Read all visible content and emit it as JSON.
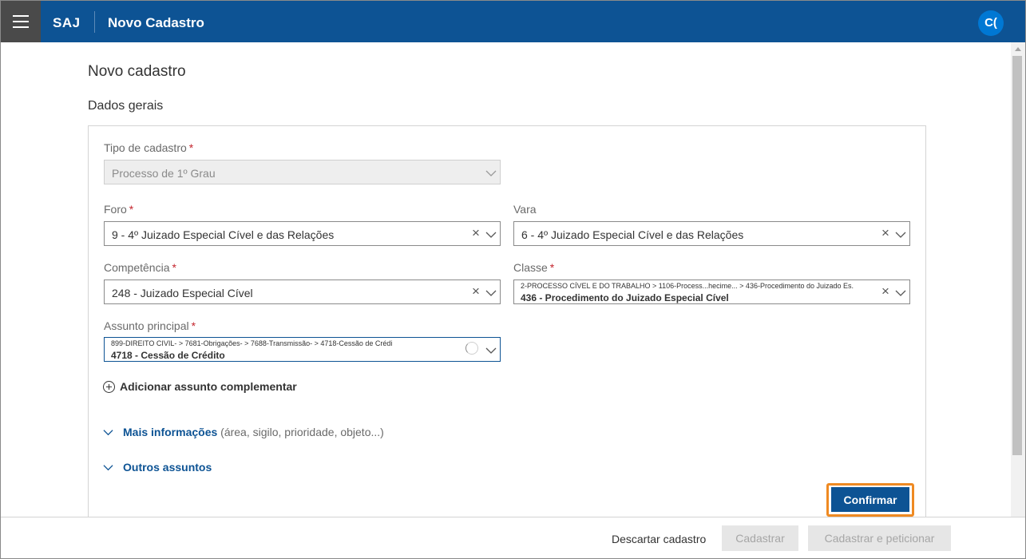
{
  "header": {
    "brand": "SAJ",
    "title": "Novo Cadastro",
    "avatar_initials": "C("
  },
  "page": {
    "title": "Novo cadastro",
    "section": "Dados gerais"
  },
  "form": {
    "tipo_cadastro": {
      "label": "Tipo de cadastro",
      "required_mark": "*",
      "value": "Processo de 1º Grau"
    },
    "foro": {
      "label": "Foro",
      "required_mark": "*",
      "value": "9 - 4º Juizado Especial Cível e das Relações"
    },
    "vara": {
      "label": "Vara",
      "value": "6 - 4º Juizado Especial Cível e das Relações"
    },
    "competencia": {
      "label": "Competência",
      "required_mark": "*",
      "value": "248 - Juizado Especial Cível"
    },
    "classe": {
      "label": "Classe",
      "required_mark": "*",
      "path": "2-PROCESSO CÍVEL E DO TRABALHO > 1106-Process...hecime... > 436-Procedimento do Juizado Es.",
      "value": "436 - Procedimento do Juizado Especial Cível"
    },
    "assunto_principal": {
      "label": "Assunto principal",
      "required_mark": "*",
      "path": "899-DIREITO CIVIL- > 7681-Obrigações- > 7688-Transmissão- > 4718-Cessão de Crédi",
      "value": "4718 - Cessão de Crédito"
    },
    "add_assunto_label": "Adicionar assunto complementar",
    "mais_informacoes": {
      "label": "Mais informações",
      "hint": "(área, sigilo, prioridade, objeto...)"
    },
    "outros_assuntos": {
      "label": "Outros assuntos"
    },
    "confirm_label": "Confirmar"
  },
  "footer": {
    "discard_label": "Descartar cadastro",
    "cadastrar_label": "Cadastrar",
    "cadastrar_peticionar_label": "Cadastrar e peticionar"
  },
  "colors": {
    "header_bg": "#0d5394",
    "accent": "#0078d4",
    "required": "#c4262e",
    "highlight": "#ef8a22"
  },
  "icons": [
    "menu-icon",
    "clear-icon",
    "chevron-down-icon",
    "loading-spinner-icon",
    "plus-circle-icon",
    "scroll-up-arrow-icon"
  ]
}
